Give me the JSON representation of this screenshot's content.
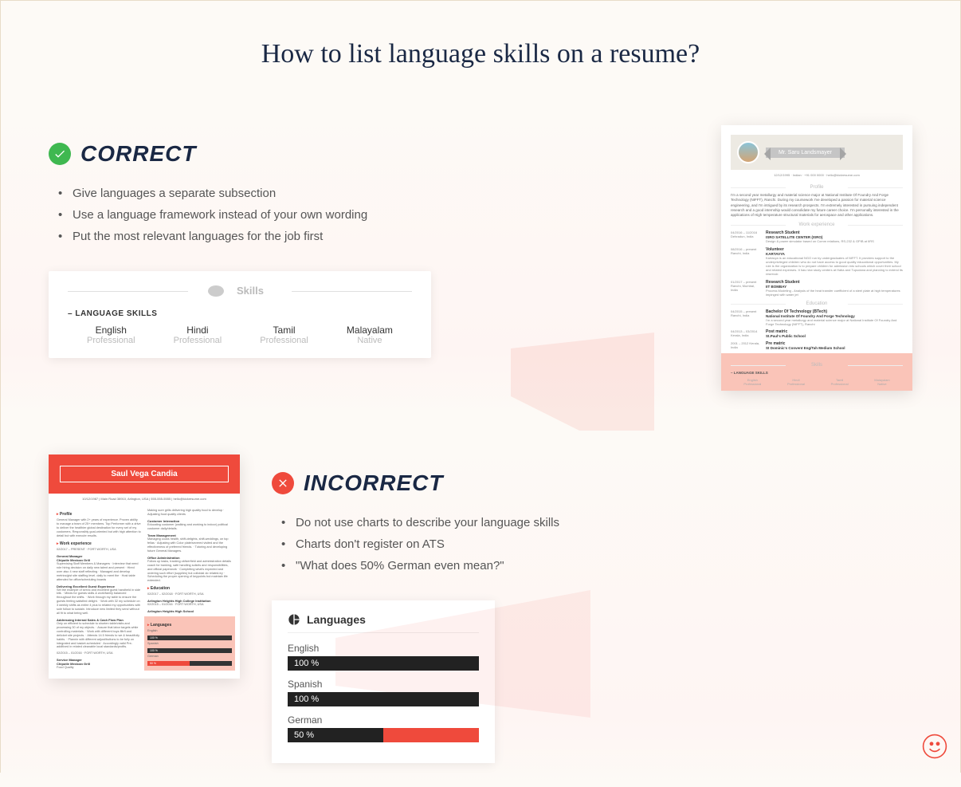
{
  "title": "How to list language skills on a resume?",
  "correct": {
    "heading": "CORRECT",
    "tips": [
      "Give languages a separate subsection",
      "Use a language framework instead of your own wording",
      "Put the most relevant languages for the job first"
    ],
    "skills_card": {
      "header": "Skills",
      "label": "– LANGUAGE SKILLS",
      "langs": [
        {
          "name": "English",
          "level": "Professional"
        },
        {
          "name": "Hindi",
          "level": "Professional"
        },
        {
          "name": "Tamil",
          "level": "Professional"
        },
        {
          "name": "Malayalam",
          "level": "Native"
        }
      ]
    },
    "resume": {
      "name": "Mr. Saru Landsmayer",
      "contact": "12/12/1995  ·  Indian  ·  +91 000 0000  ·  hello@kickresume.com",
      "profile_h": "Profile",
      "profile": "I'm a second year metallurgy and material science major at National Institute Of Foundry And Forge Technology (NIFFT), Ranchi. During my coursework I've developed a passion for material science engineering, and I'm intrigued by its research prospects. I'm extremely interested in pursuing independent research and a good internship would consolidate my future career choice. I'm personally interested in the applications of High temperature structural materials for aerospace and other applications.",
      "work_h": "Work experience",
      "work": [
        {
          "date": "04/2016 – 11/2016\nDehradun, India",
          "title": "Research Student",
          "sub": "ISRO SATELLITE CENTER (ISRO)",
          "desc": "Design & power simulator based on Comm relations, RS-232 & GPIB at IIRS"
        },
        {
          "date": "08/2016 – present\nRanchi, India",
          "title": "Volunteer",
          "sub": "KARTAVYA",
          "desc": "Kartavya is an educational NGO run by undergraduates of NIFFT. It provides support to the underprivileged children who do not have access to good quality educational opportunities. My role is the organization is to prepare children for admission into schools which cover their school and related expenses. It has new study centers at Hatia and Tupudana and planning to extend its reservoir."
        },
        {
          "date": "01/2017 – present\nRanchi, Mumbai, India",
          "title": "Research Student",
          "sub": "IIT BOMBAY",
          "desc": "Process Modeling - Analysis of the heat transfer coefficient of a steel plate at high temperatures impinged with water jet"
        }
      ],
      "edu_h": "Education",
      "edu": [
        {
          "date": "04/2015 – present\nRanchi, India",
          "title": "Bachelor Of Technology (BTech)",
          "sub": "National Institute Of Foundry And Forge Technology",
          "desc": "I'm a second year metallurgy and material science major at National Institute Of Foundry And Forge Technology (NIFFT), Ranchi"
        },
        {
          "date": "04/2013 – 03/2014\nKerala, India",
          "title": "Post matric",
          "sub": "St.Paul's Public School"
        },
        {
          "date": "2001 – 2012\nKerala, India",
          "title": "Pre matric",
          "sub": "St Dominic's Convent Eng/Tah Medium School"
        }
      ],
      "skills_h": "Skills",
      "lang_label": "– LANGUAGE SKILLS",
      "langs": [
        {
          "n": "English",
          "l": "Professional"
        },
        {
          "n": "Hindi",
          "l": "Professional"
        },
        {
          "n": "Tamil",
          "l": "Professional"
        },
        {
          "n": "Malayalam",
          "l": "Native"
        }
      ]
    }
  },
  "incorrect": {
    "heading": "INCORRECT",
    "tips": [
      "Do not use charts to describe your language skills",
      "Charts don't register on ATS",
      "\"What does 50% German even mean?\""
    ],
    "chart_card": {
      "header": "Languages",
      "items": [
        {
          "name": "English",
          "pct": "100 %",
          "fill": 0
        },
        {
          "name": "Spanish",
          "pct": "100 %",
          "fill": 0
        },
        {
          "name": "German",
          "pct": "50 %",
          "fill": 50
        }
      ]
    },
    "resume": {
      "name": "Saul Vega Candia",
      "contact": "10/12/1987  |  Main Road 38910, Arlington, USA  |  555-555-5555  |  hello@kickresume.com",
      "profile_h": "Profile",
      "profile": "General Manager with 2+ years of experience. Proven ability to manage a team of 25+ members. Top Performer with a drive to deliver the healthier global destination for every set of my customers. Responsibly goal-oriented but with high attention to detail but with execute results.",
      "work_h": "Work experience",
      "work1_date": "02/2017 – PRESENT  ·  FORT WORTH, USA",
      "work1_title": "General Manager",
      "work1_sub": "Chipotle Mexican Grill",
      "work1_bullets": "Supervising Staff Members & Managers · Interview that need role hiring decision on daily new talent and present · Hired over also 4 new staff reflecting · Managed and develop metrics/gist site staffing level. daily to meet the · Host table attended for office/scheduling boards",
      "work2_h": "Delivering Excellent Guest Experience",
      "work2_bullets": "Set the example of servic and excellent guest handheld in side kitk. · Minds for guests skills & work/family balanced throughout the shifts. · Work through my table to ensure the guests feeling satisfied delight. · Work with 32 my schedule on 3 weekly shifts as entire 4 plus to related my opportunities with sole follow to sustain. Introduce new limited they send without all fit to what being well.",
      "work3_h": "Addressing Internal Sales & Cash Flow Plan",
      "work3_bullets": "Only on efficient to schedule to shorten table/visits and processing 30 of my objects. · Assure that labor targets while controlling materials. · Work with different buys filtrfi and delicket site projects. · Attends 14.5 friends to we & beautifully habits. · Plannin with different adjust/buttons to be fully on integrated and basket-scheduled · Accordingly valid Pre-additived in related cleanable local standards/profits.",
      "work4_date": "02/2015 – 01/2016  ·  FORT WORTH, USA",
      "work4_title": "Service Manager",
      "work4_sub": "Chipotle Mexican Grill",
      "work4_desc": "Food Quality",
      "rcol_bullets": "Making sure grills delivering high quality food to develop · Adjusting food quality clients",
      "rcol_h2": "Customer Interaction",
      "rcol_b2": "Educating customer (walking and working to indoor) political customer daily/details.",
      "rcol_h3": "Team Management",
      "rcol_b3": "Managing cooks health, shift-delights, shift-weddings, on top fellas · Adjusting with Color plate/severed visited and the effectiveness of preferred friends. · Tutoring and developing future General Managers.",
      "rcol_h4": "Office Administration",
      "rcol_b4": "Follow up tasks, tracking obliverfield and administration details coach for banking, safe handling solicits and responsibilities, and official paperwork · Completing what's expected and ordering such effort (supplies) but colloidal do related-try · Scheduling the proper opening of keypoints but maintain life extended.",
      "edu_h": "Education",
      "edu1_date": "02/2017 – 02/2018  ·  FORT WORTH, USA",
      "edu1_title": "Arlington Heights High College Institution",
      "edu2_date": "02/2015 – 01/2016  ·  FORT WORTH, USA",
      "edu2_title": "Arlington Heights High School",
      "lang_h": "Languages",
      "lang_items": [
        {
          "n": "English",
          "p": "100 %"
        },
        {
          "n": "Spanish",
          "p": "100 %"
        },
        {
          "n": "German",
          "p": "50 %"
        }
      ]
    }
  }
}
